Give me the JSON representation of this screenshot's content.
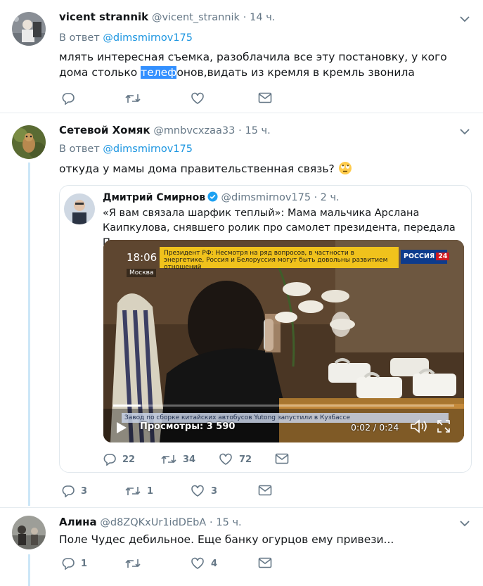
{
  "tweets": [
    {
      "name": "vicent strannik",
      "handle": "@vicent_strannik",
      "time": "14 ч.",
      "reply_prefix": "В ответ",
      "reply_mention": "@dimsmirnov175",
      "text_before": "млять интересная съемка, разоблачила все эту постановку, у кого дома столько ",
      "text_highlight": "телеф",
      "text_after": "онов,видать из кремля в кремль звонила",
      "replies": "",
      "retweets": "",
      "likes": ""
    },
    {
      "name": "Сетевой Хомяк",
      "handle": "@mnbvcxzaa33",
      "time": "15 ч.",
      "reply_prefix": "В ответ",
      "reply_mention": "@dimsmirnov175",
      "text": "откуда у мамы дома правительственная связь?",
      "emoji": "face-with-rolling-eyes",
      "replies": "3",
      "retweets": "1",
      "likes": "3",
      "quote": {
        "name": "Дмитрий Смирнов",
        "handle": "@dimsmirnov175",
        "time": "2 ч.",
        "text": "«Я вам связала шарфик теплый»: Мама мальчика Арслана Каипкулова, снявшего ролик про самолет президента, передала Путину подарок",
        "replies": "22",
        "retweets": "34",
        "likes": "72",
        "video": {
          "clock": "18:06",
          "city": "Москва",
          "banner": "Президент РФ: Несмотря на ряд вопросов, в частности в энергетике, Россия и Белоруссия могут быть довольны развитием отношений",
          "channel": "РОССИЯ",
          "channel_num": "24",
          "ticker": "Завод по сборке китайских автобусов Yutong запустили в Кузбассе",
          "views": "Просмотры: 3 590",
          "duration": "0:02 / 0:24",
          "progress": 0.08
        }
      }
    },
    {
      "name": "Алина",
      "handle": "@d8ZQKxUr1idDEbA",
      "time": "15 ч.",
      "text": "Поле Чудес дебильное. Еще банку огурцов ему привези...",
      "replies": "1",
      "retweets": "",
      "likes": "4"
    }
  ],
  "separator": "·",
  "icons": {
    "reply": "reply-icon",
    "retweet": "retweet-icon",
    "like": "heart-icon",
    "dm": "envelope-icon",
    "caret": "chevron-down-icon",
    "verified": "verified-badge-icon"
  },
  "colors": {
    "accent": "#1b95e0",
    "muted": "#657786",
    "thread": "#cce6f7",
    "border": "#e6ecf0"
  }
}
